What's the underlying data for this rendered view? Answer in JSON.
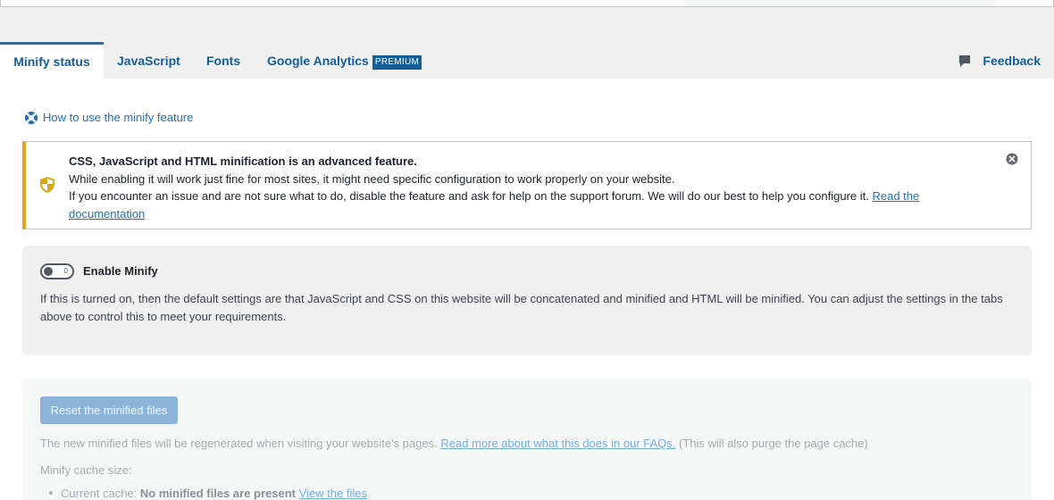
{
  "tabs": {
    "minify": "Minify status",
    "javascript": "JavaScript",
    "fonts": "Fonts",
    "ga": "Google Analytics",
    "ga_badge": "PREMIUM",
    "feedback": "Feedback"
  },
  "howto": {
    "label": "How to use the minify feature"
  },
  "notice": {
    "title": "CSS, JavaScript and HTML minification is an advanced feature.",
    "line1": "While enabling it will work just fine for most sites, it might need specific configuration to work properly on your website.",
    "line2": "If you encounter an issue and are not sure what to do, disable the feature and ask for help on the support forum. We will do our best to help you configure it.",
    "link": "Read the documentation",
    "accent_color": "#dba617"
  },
  "enable": {
    "label": "Enable Minify",
    "toggle_state": "0",
    "description": "If this is turned on, then the default settings are that JavaScript and CSS on this website will be concatenated and minified and HTML will be minified. You can adjust the settings in the tabs above to control this to meet your requirements."
  },
  "reset": {
    "button": "Reset the minified files",
    "text_before": "The new minified files will be regenerated when visiting your website's pages.",
    "link": "Read more about what this does in our FAQs.",
    "text_after": "(This will also purge the page cache)",
    "cache_size_label": "Minify cache size:",
    "current_cache_label": "Current cache:",
    "current_cache_value": "No minified files are present",
    "view_link": "View the files"
  },
  "colors": {
    "link": "#2271b1",
    "tab_active_border": "#2271b1",
    "badge_bg": "#135e96",
    "disabled_button": "#8cb4d8"
  },
  "icons": [
    "lifebuoy-icon",
    "shield-icon",
    "close-icon",
    "feedback-icon"
  ]
}
